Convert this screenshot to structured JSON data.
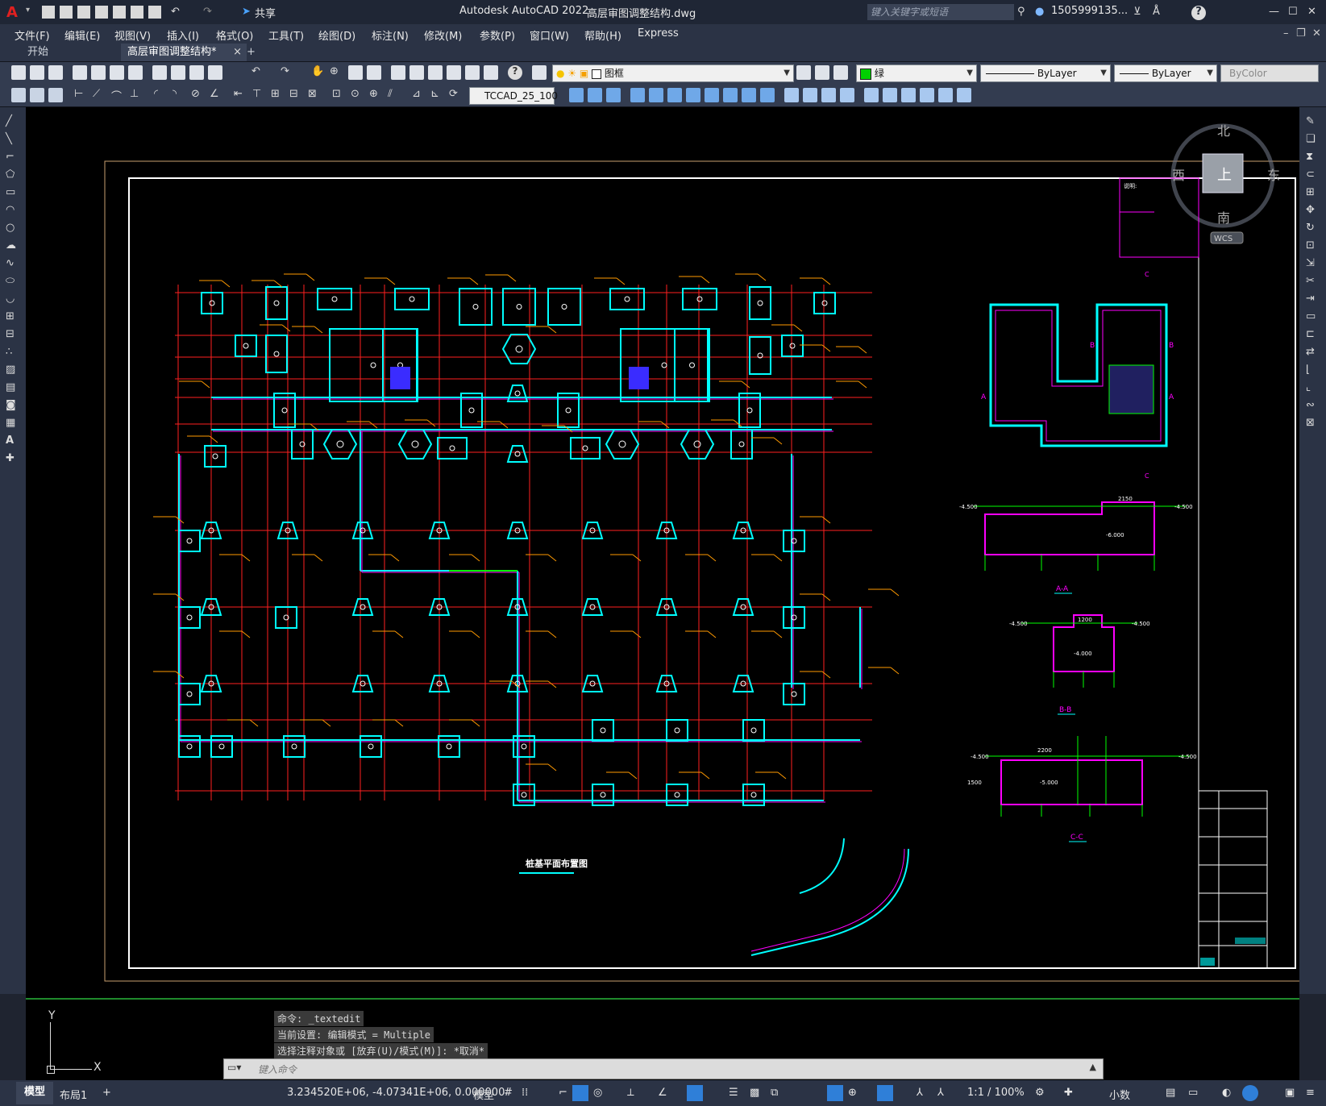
{
  "window": {
    "app_title": "Autodesk AutoCAD 2022",
    "file_title": "高层审图调整结构.dwg",
    "share_label": "共享",
    "search_placeholder": "键入关键字或短语",
    "user_label": "1505999135...",
    "help_label": "?"
  },
  "menu": [
    "文件(F)",
    "编辑(E)",
    "视图(V)",
    "插入(I)",
    "格式(O)",
    "工具(T)",
    "绘图(D)",
    "标注(N)",
    "修改(M)",
    "参数(P)",
    "窗口(W)",
    "帮助(H)",
    "Express"
  ],
  "tabs": {
    "start": "开始",
    "active": "高层审图调整结构*",
    "close": "×",
    "add": "+"
  },
  "toolbar": {
    "layer_name": "图框",
    "color_name": "绿",
    "linetype": "ByLayer",
    "lineweight": "ByLayer",
    "plotstyle": "ByColor",
    "text_style": "TCCAD_25_100"
  },
  "viewcube": {
    "north": "北",
    "south": "南",
    "east": "东",
    "west": "西",
    "face": "上",
    "wcs": "WCS"
  },
  "drawing": {
    "plan_title": "桩基平面布置图",
    "section_aa": "A-A",
    "section_bb": "B-B",
    "section_cc": "C-C",
    "note_title": "说明:",
    "dim_2150": "2150",
    "dim_1200": "1200",
    "dim_2200": "2200",
    "dim_1500": "1500",
    "elev_4500": "-4.500",
    "elev_5000": "-5.000",
    "elev_6000": "-6.000",
    "elev_4000": "-4.000",
    "section_mark_c": "C",
    "section_mark_a": "A",
    "section_mark_b": "B"
  },
  "command": {
    "line1": "命令: _textedit",
    "line2": "当前设置: 编辑模式 = Multiple",
    "line3": "选择注释对象或 [放弃(U)/模式(M)]: *取消*",
    "input_placeholder": "键入命令"
  },
  "ucs": {
    "x": "X",
    "y": "Y"
  },
  "status": {
    "model_tab": "模型",
    "layout_tab": "布局1",
    "add_tab": "+",
    "coords": "3.234520E+06, -4.07341E+06, 0.000000",
    "model": "模型",
    "scale": "1:1 / 100%",
    "units": "小数"
  },
  "colors": {
    "red_grid": "#ff2020",
    "cyan": "#00ffff",
    "magenta": "#ff00ff",
    "blue_fill": "#3a2cff",
    "green": "#1fd41f",
    "white": "#ffffff",
    "orange": "#ff9a00"
  }
}
